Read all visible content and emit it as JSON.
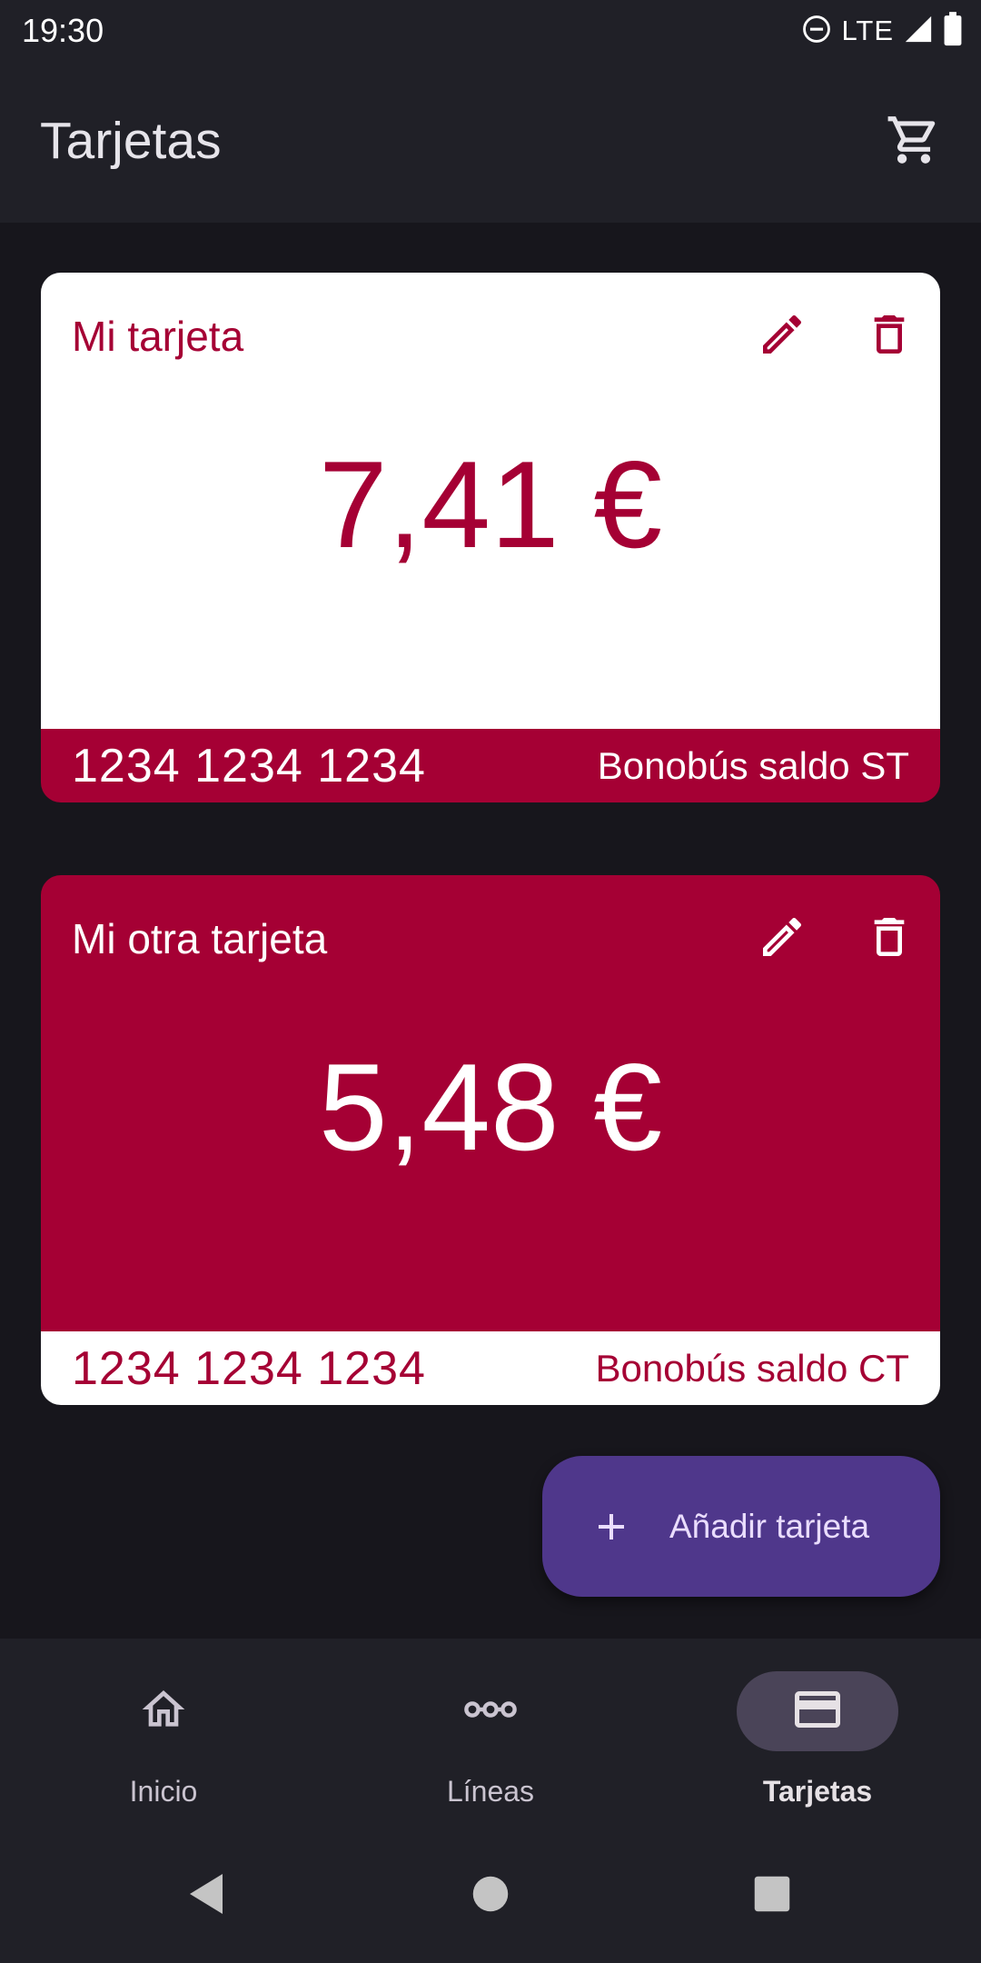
{
  "status_bar": {
    "time": "19:30",
    "network": "LTE",
    "icons": [
      "do-not-disturb-icon",
      "signal-icon",
      "battery-icon"
    ]
  },
  "app_bar": {
    "title": "Tarjetas",
    "action_icon": "cart-icon"
  },
  "cards": [
    {
      "name": "Mi tarjeta",
      "balance": "7,41 €",
      "number": "1234 1234 1234",
      "type": "Bonobús saldo ST",
      "style": "light"
    },
    {
      "name": "Mi otra tarjeta",
      "balance": "5,48 €",
      "number": "1234 1234 1234",
      "type": "Bonobús saldo CT",
      "style": "dark"
    }
  ],
  "fab": {
    "label": "Añadir tarjeta",
    "icon": "plus-icon"
  },
  "bottom_nav": {
    "items": [
      {
        "label": "Inicio",
        "icon": "home-icon",
        "selected": false
      },
      {
        "label": "Líneas",
        "icon": "route-icon",
        "selected": false
      },
      {
        "label": "Tarjetas",
        "icon": "credit-card-icon",
        "selected": true
      }
    ]
  },
  "system_nav": {
    "buttons": [
      "back-icon",
      "home-circle-icon",
      "recents-icon"
    ]
  },
  "colors": {
    "brand": "#a50034",
    "background": "#17161c",
    "surface": "#202027",
    "fab": "#4f378b",
    "nav_indicator": "#4a4458"
  }
}
